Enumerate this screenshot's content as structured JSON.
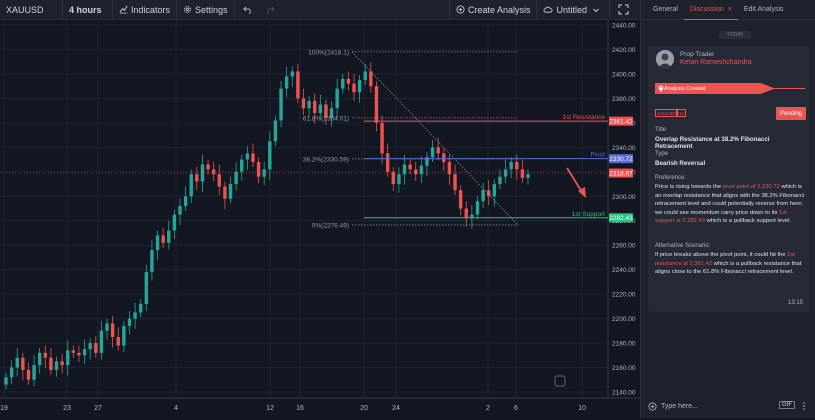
{
  "toolbar": {
    "symbol": "XAUUSD",
    "interval": "4 hours",
    "indicators": "Indicators",
    "settings": "Settings",
    "create_analysis": "Create Analysis",
    "untitled": "Untitled"
  },
  "panel": {
    "tabs": [
      "General",
      "Discussion",
      "Edit Analysis"
    ],
    "today": "TODAY",
    "role": "Prop Trader",
    "author": "Ketan Rameshchandra",
    "status_banner": "Analysis Created",
    "badges": [
      "XAUUSD",
      "H4"
    ],
    "pending": "Pending",
    "title_label": "Title",
    "title_value": "Overlap Resistance at 38.2% Fibonacci Retracement",
    "type_label": "Type",
    "type_value": "Bearish Reversal",
    "preference_label": "Preference:",
    "pref_1": "Price is rising towards the ",
    "pref_2": "pivot point of 2,330.72",
    "pref_3": " which is an overlap resistance that aligns with the 38.2% Fibonacci retracement level and could potentially reverse from here; we could see momentum carry price down to its ",
    "pref_4": "1st support at 2,282.43",
    "pref_5": " which is a pullback support level.",
    "alt_label": "Alternative Scenario:",
    "alt_1": "If price breaks above the pivot point, it could hit the ",
    "alt_2": "1st resistance at 2,361.42",
    "alt_3": " which is a pullback resistance that aligns close to the 61.8% Fibonacci retracement level.",
    "time": "13:15",
    "input_placeholder": "Type here...",
    "gif": "GIF"
  },
  "chart_data": {
    "type": "candlestick",
    "symbol": "XAUUSD",
    "ylim": [
      2140,
      2440
    ],
    "y_ticks": [
      "2440.00",
      "2420.00",
      "2400.00",
      "2380.00",
      "2360.00",
      "2340.00",
      "2320.00",
      "2300.00",
      "2280.00",
      "2260.00",
      "2240.00",
      "2220.00",
      "2200.00",
      "2180.00",
      "2160.00",
      "2140.00"
    ],
    "x_ticks": [
      "19",
      "23",
      "27",
      "4",
      "12",
      "16",
      "20",
      "24",
      "2",
      "6",
      "10"
    ],
    "fib_levels": [
      {
        "label": "100%(2418.1)",
        "value": 2418.1
      },
      {
        "label": "61.8%(2364.01)",
        "value": 2364.01
      },
      {
        "label": "38.2%(2330.59)",
        "value": 2330.59
      },
      {
        "label": "0%(2276.49)",
        "value": 2276.49
      }
    ],
    "levels": [
      {
        "name": "1st Resistance",
        "value": 2361.42,
        "price_label": "2361.42",
        "color": "#ef5350"
      },
      {
        "name": "Pivot",
        "value": 2330.72,
        "price_label": "2330.72",
        "color": "#5b6bd9"
      },
      {
        "name": "1st Support",
        "value": 2282.43,
        "price_label": "2282.43",
        "color": "#26c281"
      }
    ],
    "last_price": {
      "value": 2318.97,
      "label": "2318.97"
    },
    "closes": [
      2152,
      2160,
      2168,
      2158,
      2150,
      2162,
      2172,
      2168,
      2158,
      2165,
      2162,
      2174,
      2172,
      2170,
      2175,
      2180,
      2172,
      2190,
      2196,
      2185,
      2178,
      2194,
      2200,
      2205,
      2212,
      2238,
      2256,
      2268,
      2262,
      2272,
      2285,
      2292,
      2300,
      2318,
      2312,
      2326,
      2322,
      2318,
      2308,
      2298,
      2310,
      2320,
      2330,
      2335,
      2328,
      2316,
      2322,
      2345,
      2362,
      2388,
      2398,
      2402,
      2380,
      2372,
      2378,
      2368,
      2375,
      2364,
      2372,
      2388,
      2396,
      2392,
      2385,
      2395,
      2402,
      2390,
      2360,
      2335,
      2320,
      2310,
      2318,
      2326,
      2322,
      2318,
      2325,
      2332,
      2340,
      2335,
      2328,
      2318,
      2305,
      2290,
      2282,
      2285,
      2296,
      2305,
      2300,
      2310,
      2316,
      2322,
      2328,
      2322,
      2315,
      2318
    ]
  }
}
